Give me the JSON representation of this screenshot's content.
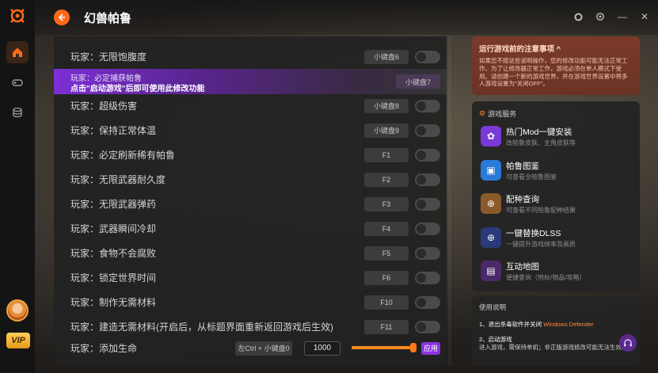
{
  "header": {
    "title": "幻兽帕鲁"
  },
  "cheats": [
    {
      "label": "玩家：无限饱腹度",
      "key": "小键盘6"
    },
    {
      "label": "玩家：必定捕获帕鲁",
      "key": "小键盘7",
      "hint": "点击\"启动游戏\"后即可使用此修改功能"
    },
    {
      "label": "玩家：超级伤害",
      "key": "小键盘8"
    },
    {
      "label": "玩家：保持正常体温",
      "key": "小键盘9"
    },
    {
      "label": "玩家：必定刷新稀有帕鲁",
      "key": "F1"
    },
    {
      "label": "玩家：无限武器耐久度",
      "key": "F2"
    },
    {
      "label": "玩家：无限武器弹药",
      "key": "F3"
    },
    {
      "label": "玩家：武器瞬间冷却",
      "key": "F4"
    },
    {
      "label": "玩家：食物不会腐败",
      "key": "F5"
    },
    {
      "label": "玩家：锁定世界时间",
      "key": "F6"
    },
    {
      "label": "玩家：制作无需材料",
      "key": "F10"
    },
    {
      "label": "玩家：建造无需材料(开启后，从标题界面重新返回游戏后生效)",
      "key": "F11"
    }
  ],
  "life_row": {
    "label": "玩家：添加生命",
    "shortcut": "左Ctrl + 小键盘0",
    "value": "1000",
    "slider_fraction": 0.95,
    "apply": "应用"
  },
  "notice": {
    "title": "运行游戏前的注意事项 ^",
    "text": "如果您不按这些说明操作，您的修改功能可能无法正常工作。为了让修改器正常工作，游戏必须在单人模式下使用。请创建一个新的游戏世界，并在游戏世界设置中将多人游戏设置为\"关闭OFF\"。"
  },
  "services": {
    "heading": "游戏服务",
    "items": [
      {
        "title": "热门Mod一键安装",
        "sub": "改帕鲁皮肤、主角皮肤等",
        "color": "#7a3ad8",
        "icon": "mod-icon"
      },
      {
        "title": "帕鲁图鉴",
        "sub": "可查看全帕鲁图鉴",
        "color": "#2a7ad8",
        "icon": "book-icon"
      },
      {
        "title": "配种查询",
        "sub": "可查看不同帕鲁配种结果",
        "color": "#8a5a2a",
        "icon": "download-icon"
      },
      {
        "title": "一键替换DLSS",
        "sub": "一键提升游戏帧率及画质",
        "color": "#2a3a7a",
        "icon": "download-icon"
      },
      {
        "title": "互动地图",
        "sub": "便捷查询（地标/物品/攻略）",
        "color": "#4a2a6a",
        "icon": "map-icon"
      }
    ]
  },
  "usage": {
    "title": "使用说明",
    "step1_prefix": "1、退出杀毒软件并关闭 ",
    "step1_highlight": "Windows Defender",
    "step2_title": "2、启动游戏",
    "step2_text": "进入游戏，需保持单机；非正版游戏修改可能无法生效。"
  },
  "colors": {
    "accent": "#ff6a1a",
    "purple": "#8a35e0"
  }
}
